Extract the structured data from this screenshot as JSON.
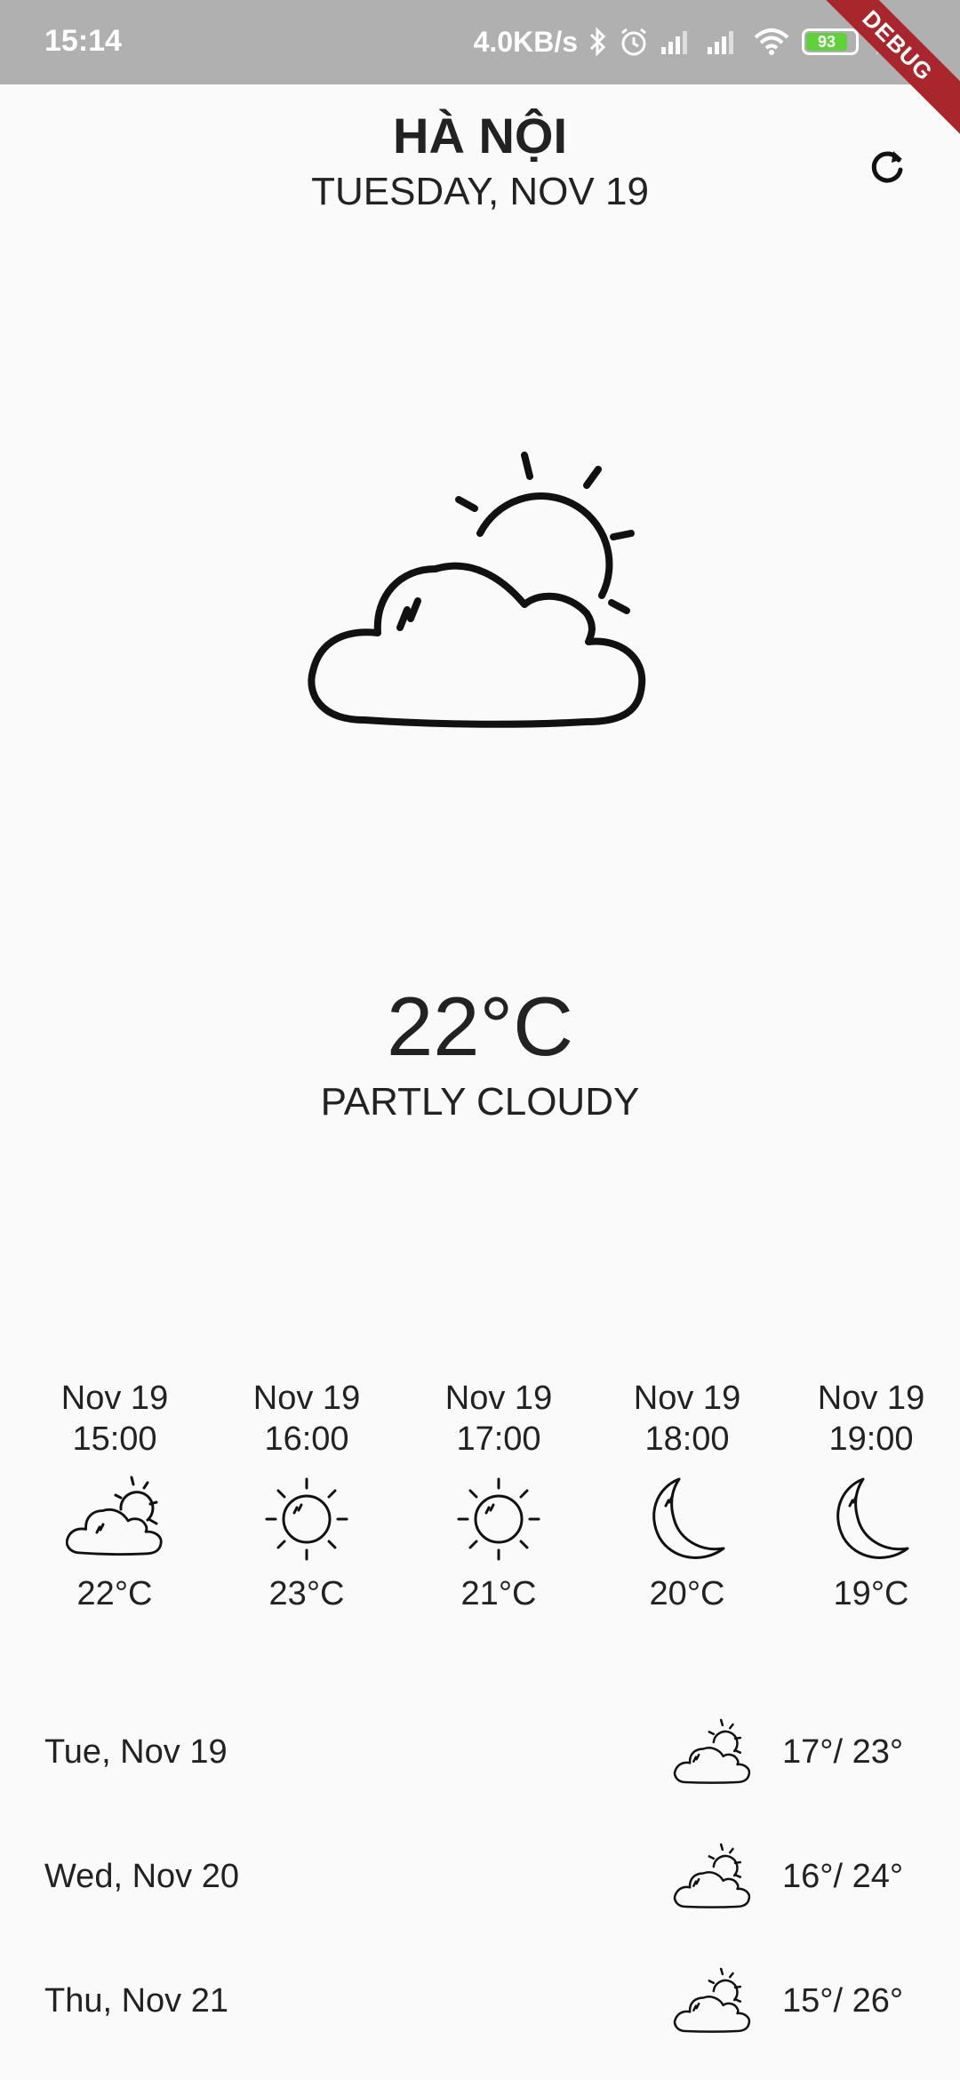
{
  "status_bar": {
    "time": "15:14",
    "network_speed": "4.0KB/s",
    "battery_level": "93",
    "icons": [
      "bluetooth-icon",
      "alarm-icon",
      "signal-icon",
      "signal-icon",
      "wifi-icon",
      "battery-icon",
      "charging-icon"
    ]
  },
  "debug_banner": "DEBUG",
  "header": {
    "city": "HÀ NỘI",
    "date": "TUESDAY, NOV 19",
    "refresh_icon": "refresh-icon"
  },
  "current": {
    "icon": "partly-cloudy-icon",
    "temperature": "22°C",
    "condition": "PARTLY CLOUDY"
  },
  "hourly": [
    {
      "date": "Nov 19",
      "time": "15:00",
      "temp": "22°C",
      "icon": "partly-cloudy-icon"
    },
    {
      "date": "Nov 19",
      "time": "16:00",
      "temp": "23°C",
      "icon": "sun-icon"
    },
    {
      "date": "Nov 19",
      "time": "17:00",
      "temp": "21°C",
      "icon": "sun-icon"
    },
    {
      "date": "Nov 19",
      "time": "18:00",
      "temp": "20°C",
      "icon": "moon-icon"
    },
    {
      "date": "Nov 19",
      "time": "19:00",
      "temp": "19°C",
      "icon": "moon-icon"
    }
  ],
  "daily": [
    {
      "day": "Tue, Nov 19",
      "range": "17°/ 23°",
      "icon": "partly-cloudy-icon"
    },
    {
      "day": "Wed, Nov 20",
      "range": "16°/ 24°",
      "icon": "partly-cloudy-icon"
    },
    {
      "day": "Thu, Nov 21",
      "range": "15°/ 26°",
      "icon": "partly-cloudy-icon"
    }
  ],
  "colors": {
    "background": "#fafafa",
    "status_bar": "#b0b0b0",
    "text": "#222222",
    "debug_banner": "#a8262c",
    "battery": "#5fd13a"
  }
}
